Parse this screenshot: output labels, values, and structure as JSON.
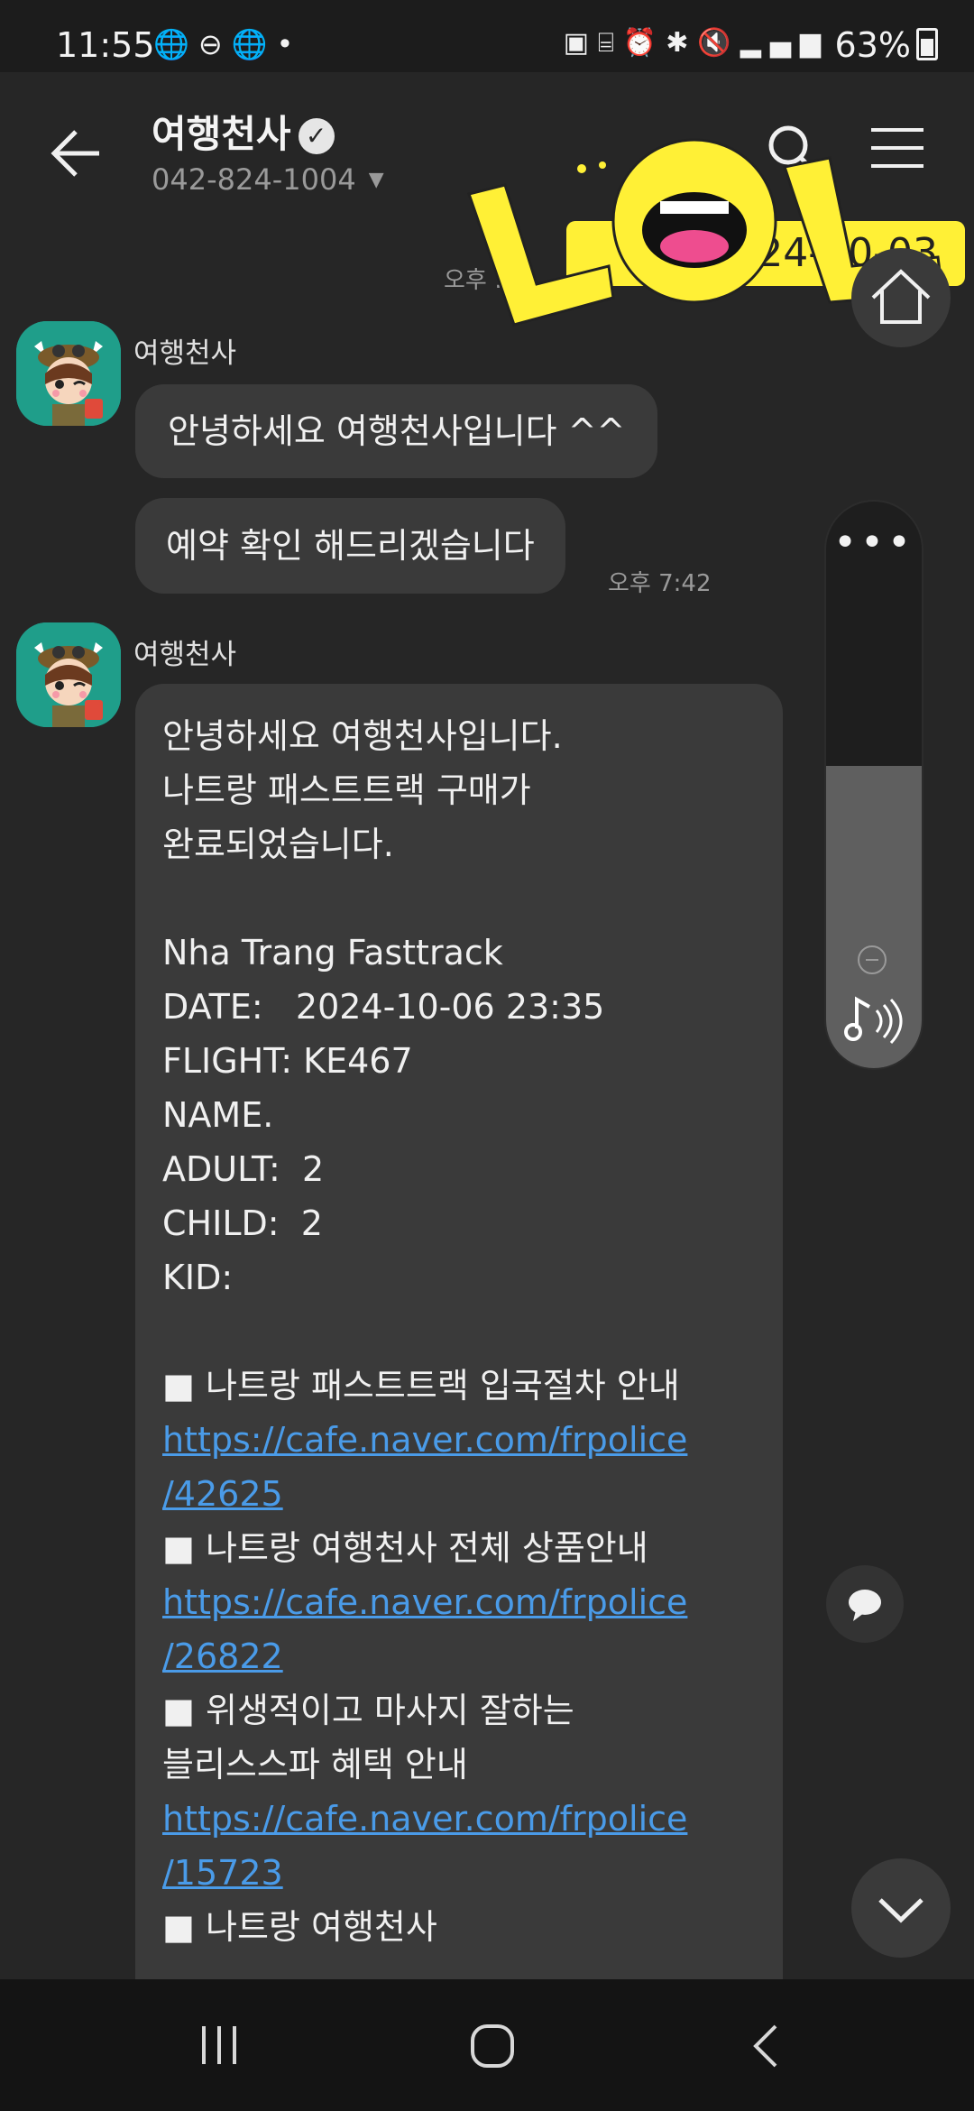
{
  "status_bar": {
    "time": "11:55",
    "left_icons": [
      "globe-icon",
      "minus-circle-icon",
      "globe-icon",
      "dot-icon"
    ],
    "right_icons": [
      "sim-icon",
      "bed-icon",
      "alarm-icon",
      "bluetooth-icon",
      "mute-icon",
      "signal-icon"
    ],
    "battery": "63%"
  },
  "header": {
    "title": "여행천사",
    "phone": "042-824-1004"
  },
  "sticker": {
    "text": "LOL",
    "date": "4/2024-10-03",
    "time_partial": "오후 :37"
  },
  "messages": [
    {
      "sender": "여행천사",
      "bubbles": [
        "안녕하세요 여행천사입니다 ^^",
        "예약 확인 해드리겠습니다"
      ],
      "time": "오후 7:42"
    },
    {
      "sender": "여행천사",
      "body_lines": [
        "안녕하세요 여행천사입니다.",
        "나트랑 패스트트랙 구매가",
        "완료되었습니다.",
        "",
        "Nha Trang Fasttrack",
        "DATE:   2024-10-06 23:35",
        "FLIGHT: KE467",
        "NAME.",
        "ADULT:  2",
        "CHILD:  2",
        "KID:",
        "",
        "■ 나트랑 패스트트랙 입국절차 안내"
      ],
      "link1": [
        "https://cafe.naver.com/frpolice",
        "/42625"
      ],
      "line2": "■ 나트랑 여행천사 전체 상품안내",
      "link2": [
        "https://cafe.naver.com/frpolice",
        "/26822"
      ],
      "line3a": "■ 위생적이고 마사지 잘하는",
      "line3b": "블리스스파 혜택 안내",
      "link3": [
        "https://cafe.naver.com/frpolice",
        "/15723"
      ],
      "line4": "■ 나트랑 여행천사"
    }
  ],
  "volume_panel": {
    "more": "•••",
    "level": 0.53
  },
  "colors": {
    "background": "#262626",
    "bubble": "#3a3a3a",
    "link": "#4a9be8",
    "sticker_yellow": "#fff036"
  }
}
